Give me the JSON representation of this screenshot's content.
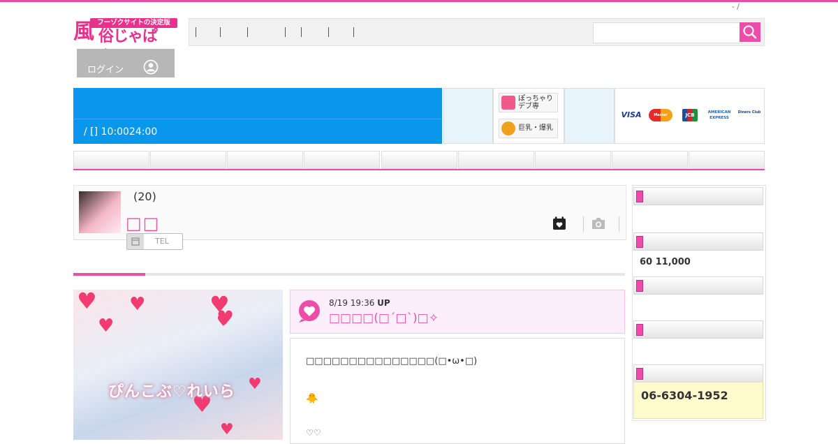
{
  "header": {
    "top_links": "- /",
    "logo": {
      "tagline": "フーゾクサイトの決定版",
      "mark": "風",
      "title": "俗じゃぱん!"
    },
    "breadcrumb": "/ /",
    "login_label": "ログイン",
    "search": {
      "placeholder": ""
    }
  },
  "shop": {
    "hours": "/ [] 10:0024:00",
    "badges": [
      {
        "label": "ぽっちゃり\nデブ専"
      },
      {
        "label": "巨乳・爆乳"
      }
    ],
    "cards": [
      "VISA",
      "Master",
      "JCB",
      "AMERICAN EXPRESS",
      "Diners Club"
    ],
    "colors": {
      "blue": "#0a96ea",
      "pink": "#ee4ca9"
    }
  },
  "profile": {
    "age": "(20)",
    "name": "□□",
    "tel_label": "TEL",
    "progress": 0.13
  },
  "blog": {
    "image_caption": "ぴんこぶ♡れいら",
    "date": "8/19 19:36",
    "up_label": "UP",
    "title": "□□□□(□´□`)□✧",
    "line1": "□□□□□□□□□□□□□□□(□•ω•□)",
    "line2": "🐥",
    "line3": "♡♡"
  },
  "sidebar": {
    "price": "60 11,000",
    "phone": "06-6304-1952"
  }
}
